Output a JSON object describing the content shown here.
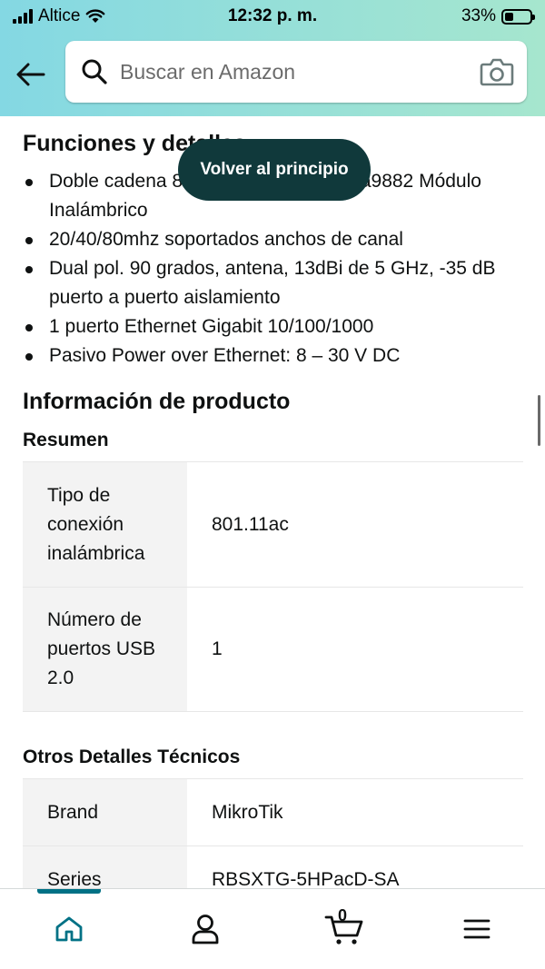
{
  "status_bar": {
    "carrier": "Altice",
    "time": "12:32 p. m.",
    "battery": "33%",
    "battery_level": 0.33
  },
  "search": {
    "placeholder": "Buscar en Amazon"
  },
  "features": {
    "title": "Funciones y detalles",
    "items": [
      "Doble cadena 802.11ac de 5 GHz qca9882 Módulo Inalámbrico",
      "20/40/80mhz soportados anchos de canal",
      "Dual pol. 90 grados, antena, 13dBi de 5 GHz, -35 dB puerto a puerto aislamiento",
      "1 puerto Ethernet Gigabit 10/100/1000",
      "Pasivo Power over Ethernet: 8 – 30 V DC"
    ]
  },
  "tooltip": {
    "label": "Volver al principio"
  },
  "product_info": {
    "title": "Información de producto",
    "summary_title": "Resumen",
    "summary_rows": [
      {
        "key": "Tipo de conexión inalámbrica",
        "value": "801.11ac"
      },
      {
        "key": "Número de puertos USB 2.0",
        "value": "1"
      }
    ],
    "other_title": "Otros Detalles Técnicos",
    "other_rows": [
      {
        "key": "Brand",
        "value": "MikroTik"
      },
      {
        "key": "Series",
        "value": "RBSXTG-5HPacD-SA"
      }
    ]
  },
  "bottom_nav": {
    "cart_count": "0",
    "active": "home"
  },
  "colors": {
    "header_gradient_start": "#84d8e3",
    "header_gradient_end": "#a6e6ce",
    "tooltip_bg": "#10393b",
    "nav_active": "#007185",
    "table_key_bg": "#f3f3f3"
  }
}
